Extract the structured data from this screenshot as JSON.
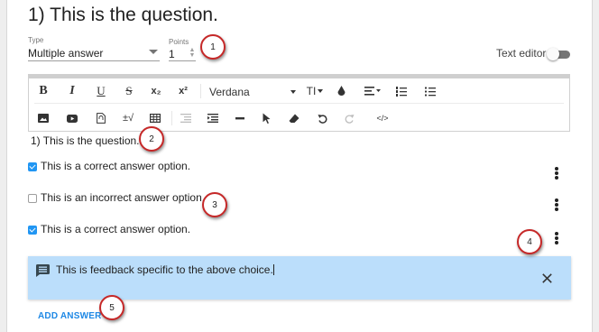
{
  "question": {
    "title": "1) This is the question.",
    "body_text": "1)  This is the question."
  },
  "type_field": {
    "label": "Type",
    "value": "Multiple answer"
  },
  "points_field": {
    "label": "Points",
    "value": "1"
  },
  "text_editor": {
    "label": "Text editor",
    "enabled": false
  },
  "toolbar": {
    "row1": [
      "bold-icon",
      "italic-icon",
      "underline-icon",
      "strikethrough-icon",
      "subscript-icon",
      "superscript-icon",
      "font-family-select",
      "font-size-icon",
      "text-color-icon",
      "align-icon",
      "numbered-list-icon",
      "bulleted-list-icon"
    ],
    "row2": [
      "image-icon",
      "video-icon",
      "file-icon",
      "math-icon",
      "table-icon",
      "outdent-icon",
      "indent-icon",
      "horizontal-rule-icon",
      "pointer-icon",
      "eraser-icon",
      "undo-icon",
      "redo-icon",
      "code-icon"
    ],
    "bold": "B",
    "italic": "I",
    "underline": "U",
    "strike": "S",
    "subscript": "x₂",
    "superscript": "x²",
    "font": "Verdana",
    "font_size": "TI",
    "math": "±√",
    "code": "</>"
  },
  "answers": [
    {
      "text": "This is a correct answer option.",
      "checked": true
    },
    {
      "text": "This is an incorrect answer option.",
      "checked": false
    },
    {
      "text": "This is a correct answer option.",
      "checked": true
    }
  ],
  "feedback": {
    "text": "This is feedback specific to the above choice."
  },
  "add_answer": {
    "label": "ADD ANSWER"
  },
  "markers": [
    "1",
    "2",
    "3",
    "4",
    "5"
  ],
  "colors": {
    "accent": "#2196f3",
    "feedback_bg": "#bbdefb",
    "marker_border": "#c62828",
    "add_answer": "#1e88e5"
  }
}
